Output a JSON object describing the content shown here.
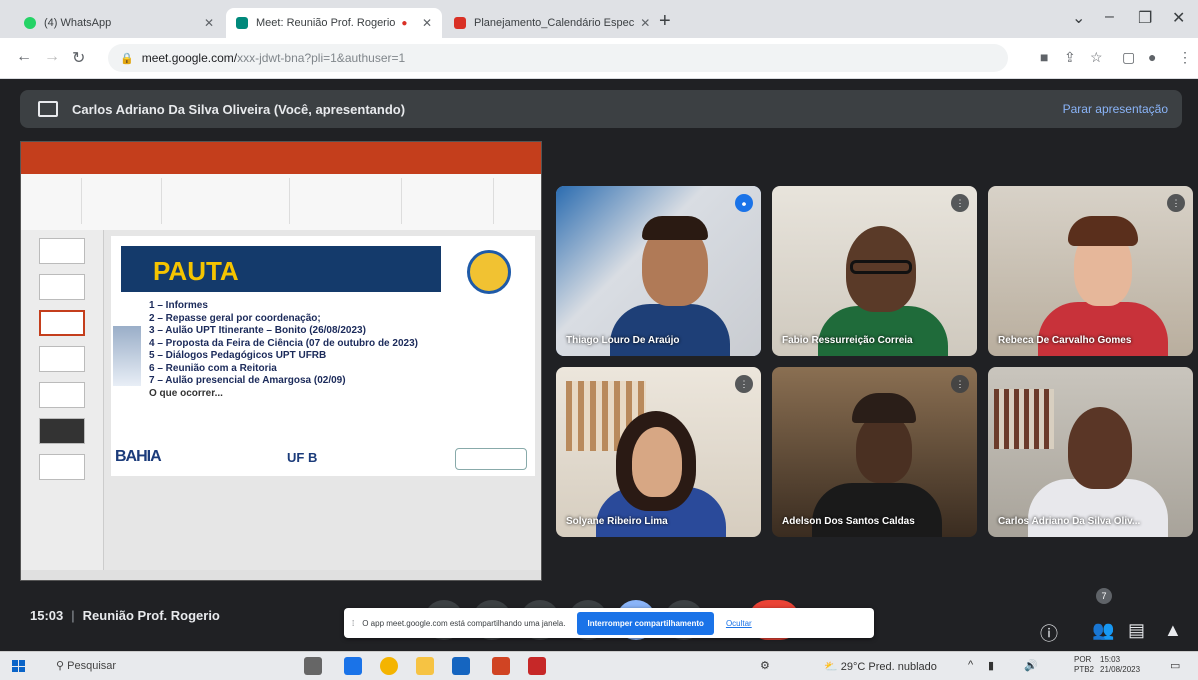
{
  "browser": {
    "tabs": [
      {
        "title": "(4) WhatsApp",
        "icon_color": "#25d366"
      },
      {
        "title": "Meet: Reunião Prof. Rogerio",
        "icon_color": "#00897b"
      },
      {
        "title": "Planejamento_Calendário Espec",
        "icon_color": "#d93025"
      }
    ],
    "new_tab_label": "+",
    "url_domain": "meet.google.com/",
    "url_path": "xxx-jdwt-bna?pli=1&authuser=1"
  },
  "meet": {
    "presenter_text": "Carlos Adriano Da Silva Oliveira (Você, apresentando)",
    "stop_presenting_label": "Parar apresentação",
    "time": "15:03",
    "meeting_title": "Reunião Prof. Rogerio",
    "participants_count": "7",
    "share_notice_text": "O app meet.google.com está compartilhando uma janela.",
    "share_stop_label": "Interromper compartilhamento",
    "share_hide_label": "Ocultar"
  },
  "slide": {
    "title": "PAUTA",
    "agenda": [
      "1 – Informes",
      "2 – Repasse geral por coordenação;",
      "3 – Aulão UPT Itinerante – Bonito (26/08/2023)",
      "4 – Proposta da Feira de Ciência (07 de outubro de 2023)",
      "5 – Diálogos Pedagógicos UPT UFRB",
      "6 – Reunião com a Reitoria",
      "7 – Aulão presencial de Amargosa (02/09)",
      "O que ocorrer..."
    ],
    "footer_left": "BAHIA",
    "footer_mid": "UF B"
  },
  "participants": [
    {
      "name": "Thiago Louro De Araújo",
      "speaking": true
    },
    {
      "name": "Fabio Ressurreição Correia",
      "speaking": false
    },
    {
      "name": "Rebeca De Carvalho Gomes",
      "speaking": false
    },
    {
      "name": "Solyane Ribeiro Lima",
      "speaking": false
    },
    {
      "name": "Adelson Dos Santos Caldas",
      "speaking": false
    },
    {
      "name": "Carlos Adriano Da Silva Oliv...",
      "speaking": false
    }
  ],
  "taskbar": {
    "search_placeholder": "Pesquisar",
    "weather": "29°C Pred. nublado",
    "lang": "POR",
    "lang2": "PTB2",
    "clock_time": "15:03",
    "clock_date": "21/08/2023"
  }
}
